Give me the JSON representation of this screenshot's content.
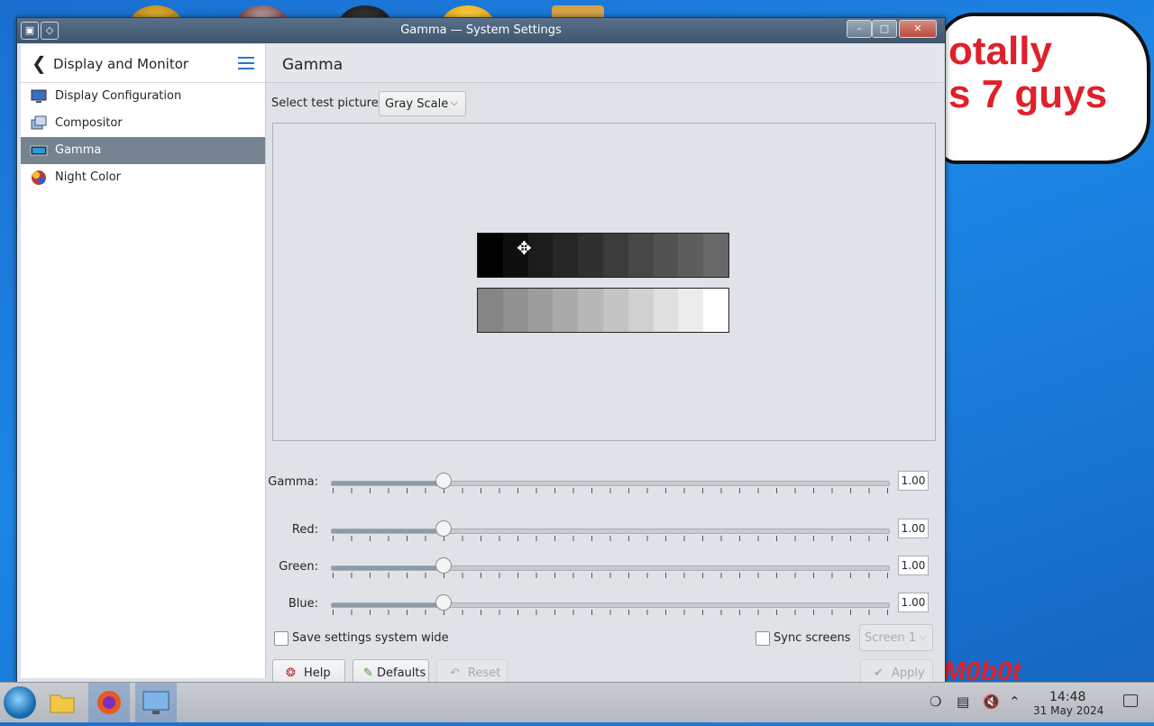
{
  "window": {
    "title": "Gamma — System Settings"
  },
  "sidebar": {
    "title": "Display and Monitor",
    "items": [
      {
        "label": "Display Configuration"
      },
      {
        "label": "Compositor"
      },
      {
        "label": "Gamma"
      },
      {
        "label": "Night Color"
      }
    ],
    "selected": "Gamma"
  },
  "page": {
    "title": "Gamma",
    "select_label": "Select test picture:",
    "test_picture": "Gray Scale"
  },
  "sliders": {
    "gamma": {
      "label": "Gamma:",
      "value": "1.00",
      "fraction": 0.2
    },
    "red": {
      "label": "Red:",
      "value": "1.00",
      "fraction": 0.2
    },
    "green": {
      "label": "Green:",
      "value": "1.00",
      "fraction": 0.2
    },
    "blue": {
      "label": "Blue:",
      "value": "1.00",
      "fraction": 0.2
    }
  },
  "options": {
    "save_system_wide": "Save settings system wide",
    "sync_screens": "Sync screens",
    "screen": "Screen 1"
  },
  "buttons": {
    "help": "Help",
    "defaults": "Defaults",
    "reset": "Reset",
    "apply": "Apply"
  },
  "desktop": {
    "speech_line1": "otally",
    "speech_line2": "s 7 guys",
    "watermark": "M0b0t"
  },
  "taskbar": {
    "time": "14:48",
    "date": "31 May 2024"
  },
  "colors": {
    "selection": "#758490",
    "accent": "#3074c4"
  }
}
